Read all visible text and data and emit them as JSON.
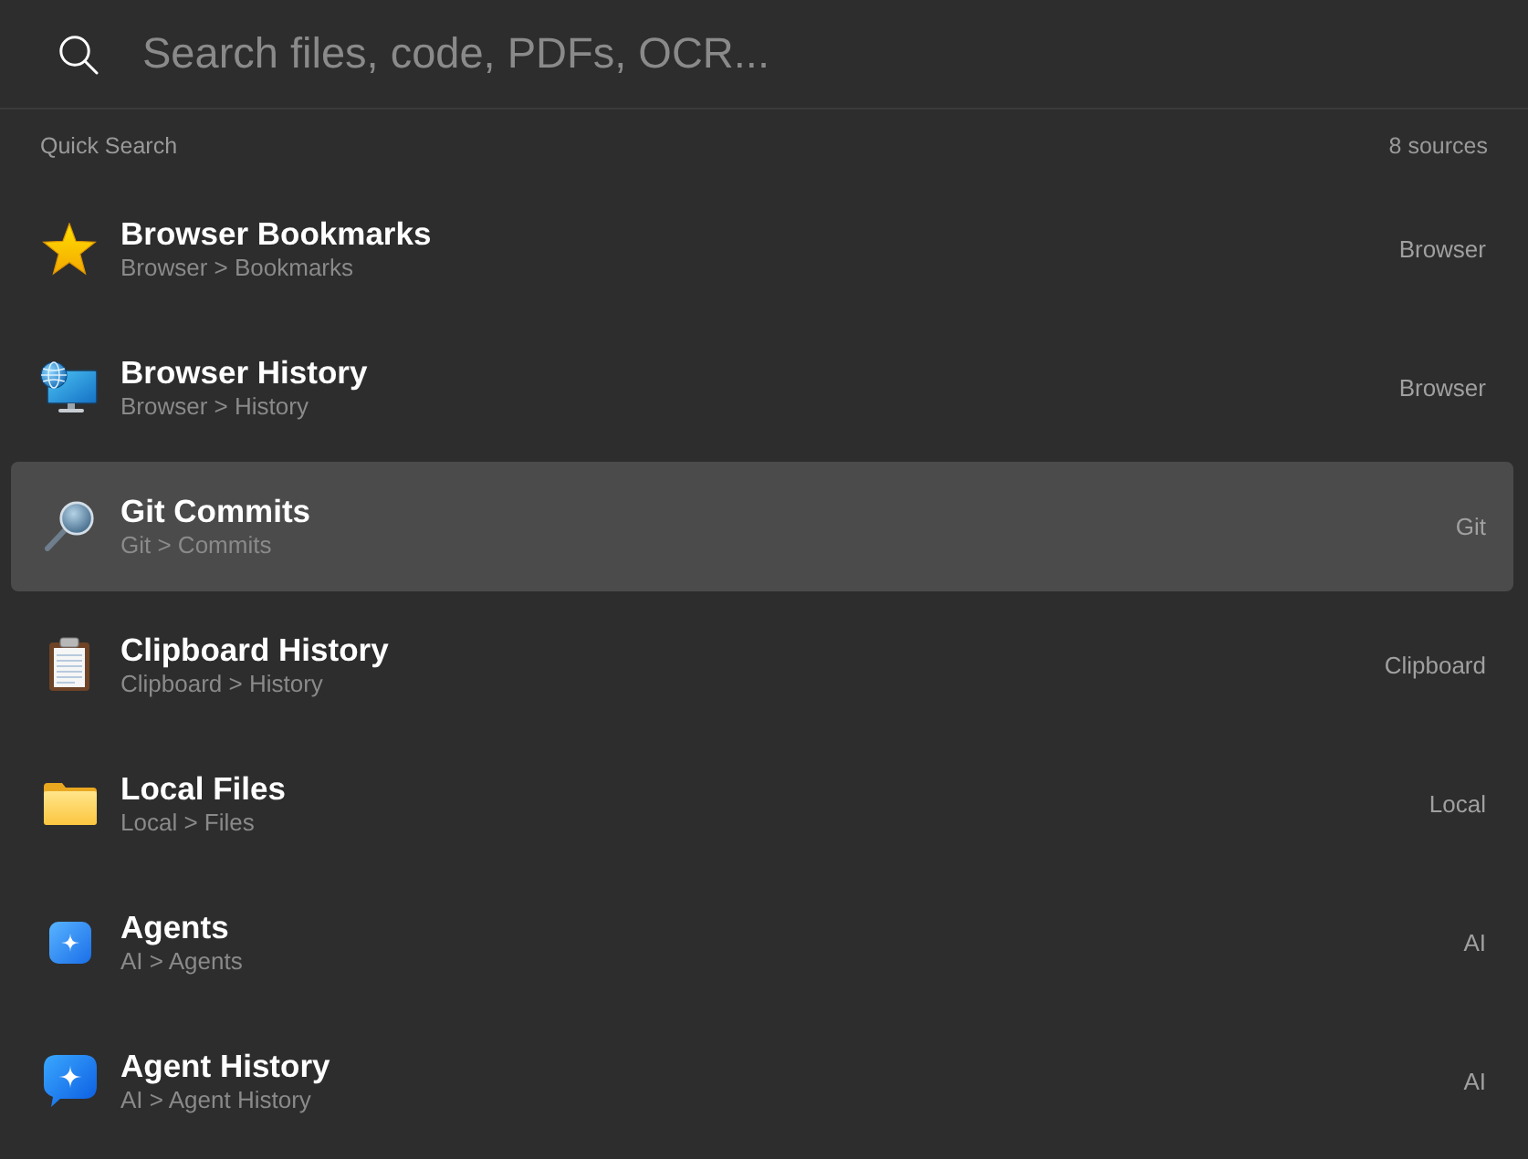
{
  "search": {
    "placeholder": "Search files, code, PDFs, OCR..."
  },
  "section": {
    "title": "Quick Search",
    "count": "8 sources"
  },
  "items": [
    {
      "kind": "star",
      "title": "Browser Bookmarks",
      "path": "Browser > Bookmarks",
      "source": "Browser",
      "selected": false
    },
    {
      "kind": "monitor",
      "title": "Browser History",
      "path": "Browser > History",
      "source": "Browser",
      "selected": false
    },
    {
      "kind": "magnifier",
      "title": "Git Commits",
      "path": "Git > Commits",
      "source": "Git",
      "selected": true
    },
    {
      "kind": "clipboard",
      "title": "Clipboard History",
      "path": "Clipboard > History",
      "source": "Clipboard",
      "selected": false
    },
    {
      "kind": "folder",
      "title": "Local Files",
      "path": "Local > Files",
      "source": "Local",
      "selected": false
    },
    {
      "kind": "sparkle_tile",
      "title": "Agents",
      "path": "AI > Agents",
      "source": "AI",
      "selected": false
    },
    {
      "kind": "sparkle_bubble",
      "title": "Agent History",
      "path": "AI > Agent History",
      "source": "AI",
      "selected": false
    }
  ]
}
